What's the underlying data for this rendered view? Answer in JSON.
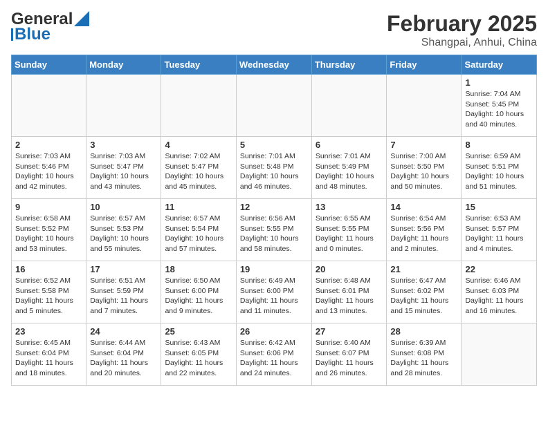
{
  "header": {
    "logo_general": "General",
    "logo_blue": "Blue",
    "title": "February 2025",
    "subtitle": "Shangpai, Anhui, China"
  },
  "days_of_week": [
    "Sunday",
    "Monday",
    "Tuesday",
    "Wednesday",
    "Thursday",
    "Friday",
    "Saturday"
  ],
  "weeks": [
    [
      {
        "day": "",
        "info": ""
      },
      {
        "day": "",
        "info": ""
      },
      {
        "day": "",
        "info": ""
      },
      {
        "day": "",
        "info": ""
      },
      {
        "day": "",
        "info": ""
      },
      {
        "day": "",
        "info": ""
      },
      {
        "day": "1",
        "info": "Sunrise: 7:04 AM\nSunset: 5:45 PM\nDaylight: 10 hours and 40 minutes."
      }
    ],
    [
      {
        "day": "2",
        "info": "Sunrise: 7:03 AM\nSunset: 5:46 PM\nDaylight: 10 hours and 42 minutes."
      },
      {
        "day": "3",
        "info": "Sunrise: 7:03 AM\nSunset: 5:47 PM\nDaylight: 10 hours and 43 minutes."
      },
      {
        "day": "4",
        "info": "Sunrise: 7:02 AM\nSunset: 5:47 PM\nDaylight: 10 hours and 45 minutes."
      },
      {
        "day": "5",
        "info": "Sunrise: 7:01 AM\nSunset: 5:48 PM\nDaylight: 10 hours and 46 minutes."
      },
      {
        "day": "6",
        "info": "Sunrise: 7:01 AM\nSunset: 5:49 PM\nDaylight: 10 hours and 48 minutes."
      },
      {
        "day": "7",
        "info": "Sunrise: 7:00 AM\nSunset: 5:50 PM\nDaylight: 10 hours and 50 minutes."
      },
      {
        "day": "8",
        "info": "Sunrise: 6:59 AM\nSunset: 5:51 PM\nDaylight: 10 hours and 51 minutes."
      }
    ],
    [
      {
        "day": "9",
        "info": "Sunrise: 6:58 AM\nSunset: 5:52 PM\nDaylight: 10 hours and 53 minutes."
      },
      {
        "day": "10",
        "info": "Sunrise: 6:57 AM\nSunset: 5:53 PM\nDaylight: 10 hours and 55 minutes."
      },
      {
        "day": "11",
        "info": "Sunrise: 6:57 AM\nSunset: 5:54 PM\nDaylight: 10 hours and 57 minutes."
      },
      {
        "day": "12",
        "info": "Sunrise: 6:56 AM\nSunset: 5:55 PM\nDaylight: 10 hours and 58 minutes."
      },
      {
        "day": "13",
        "info": "Sunrise: 6:55 AM\nSunset: 5:55 PM\nDaylight: 11 hours and 0 minutes."
      },
      {
        "day": "14",
        "info": "Sunrise: 6:54 AM\nSunset: 5:56 PM\nDaylight: 11 hours and 2 minutes."
      },
      {
        "day": "15",
        "info": "Sunrise: 6:53 AM\nSunset: 5:57 PM\nDaylight: 11 hours and 4 minutes."
      }
    ],
    [
      {
        "day": "16",
        "info": "Sunrise: 6:52 AM\nSunset: 5:58 PM\nDaylight: 11 hours and 5 minutes."
      },
      {
        "day": "17",
        "info": "Sunrise: 6:51 AM\nSunset: 5:59 PM\nDaylight: 11 hours and 7 minutes."
      },
      {
        "day": "18",
        "info": "Sunrise: 6:50 AM\nSunset: 6:00 PM\nDaylight: 11 hours and 9 minutes."
      },
      {
        "day": "19",
        "info": "Sunrise: 6:49 AM\nSunset: 6:00 PM\nDaylight: 11 hours and 11 minutes."
      },
      {
        "day": "20",
        "info": "Sunrise: 6:48 AM\nSunset: 6:01 PM\nDaylight: 11 hours and 13 minutes."
      },
      {
        "day": "21",
        "info": "Sunrise: 6:47 AM\nSunset: 6:02 PM\nDaylight: 11 hours and 15 minutes."
      },
      {
        "day": "22",
        "info": "Sunrise: 6:46 AM\nSunset: 6:03 PM\nDaylight: 11 hours and 16 minutes."
      }
    ],
    [
      {
        "day": "23",
        "info": "Sunrise: 6:45 AM\nSunset: 6:04 PM\nDaylight: 11 hours and 18 minutes."
      },
      {
        "day": "24",
        "info": "Sunrise: 6:44 AM\nSunset: 6:04 PM\nDaylight: 11 hours and 20 minutes."
      },
      {
        "day": "25",
        "info": "Sunrise: 6:43 AM\nSunset: 6:05 PM\nDaylight: 11 hours and 22 minutes."
      },
      {
        "day": "26",
        "info": "Sunrise: 6:42 AM\nSunset: 6:06 PM\nDaylight: 11 hours and 24 minutes."
      },
      {
        "day": "27",
        "info": "Sunrise: 6:40 AM\nSunset: 6:07 PM\nDaylight: 11 hours and 26 minutes."
      },
      {
        "day": "28",
        "info": "Sunrise: 6:39 AM\nSunset: 6:08 PM\nDaylight: 11 hours and 28 minutes."
      },
      {
        "day": "",
        "info": ""
      }
    ]
  ]
}
